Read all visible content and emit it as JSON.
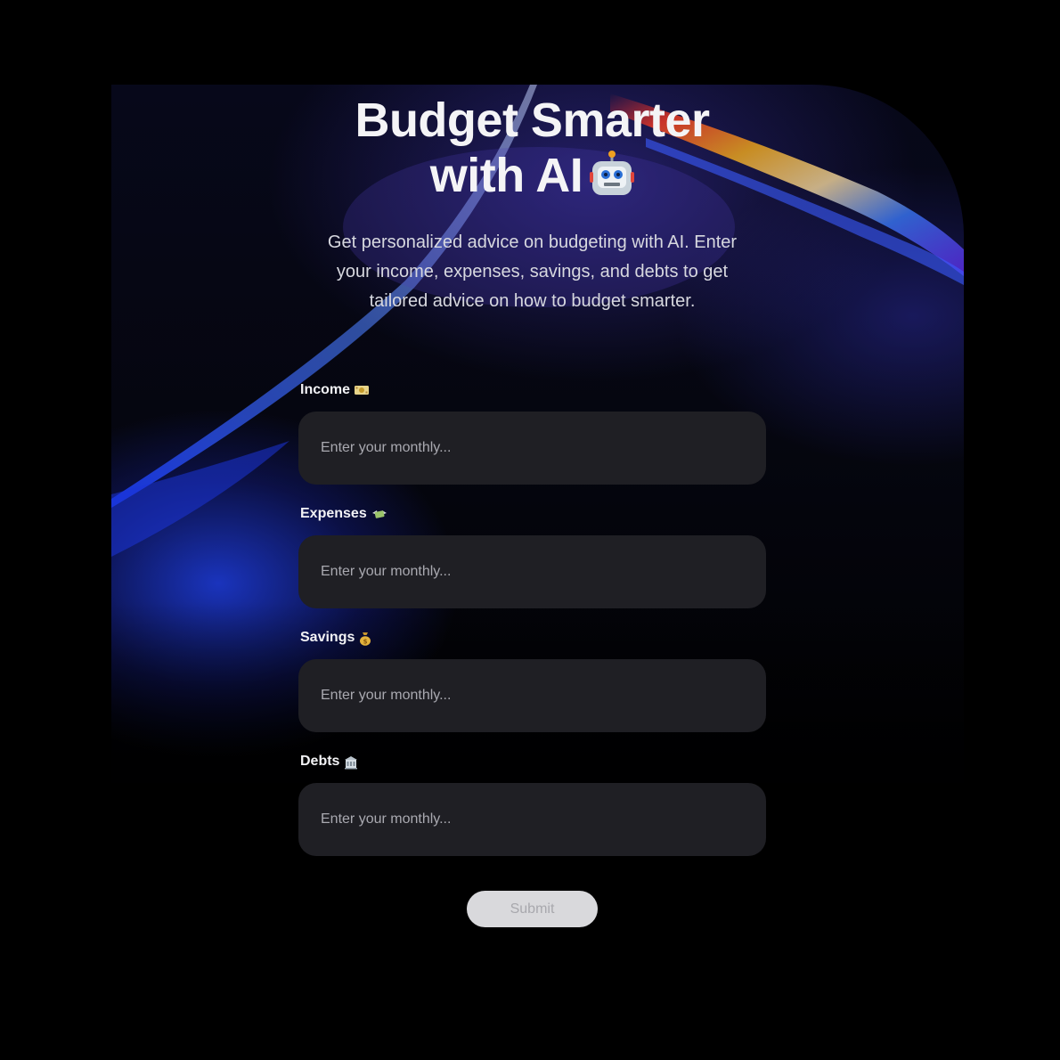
{
  "header": {
    "title_line1": "Budget Smarter",
    "title_line2": "with AI",
    "title_icon": "robot-icon",
    "description": "Get personalized advice on budgeting with AI. Enter your income, expenses, savings, and debts to get tailored advice on how to budget smarter."
  },
  "form": {
    "fields": [
      {
        "label": "Income",
        "icon": "money-bill-icon",
        "placeholder": "Enter your monthly..."
      },
      {
        "label": "Expenses",
        "icon": "money-with-wings-icon",
        "placeholder": "Enter your monthly..."
      },
      {
        "label": "Savings",
        "icon": "money-bag-icon",
        "placeholder": "Enter your monthly..."
      },
      {
        "label": "Debts",
        "icon": "bank-icon",
        "placeholder": "Enter your monthly..."
      }
    ],
    "submit_label": "Submit"
  },
  "colors": {
    "background": "#000000",
    "input_background": "#1f1f24",
    "button_background": "#d9d9dc",
    "accent_blue": "#2a3cff"
  }
}
